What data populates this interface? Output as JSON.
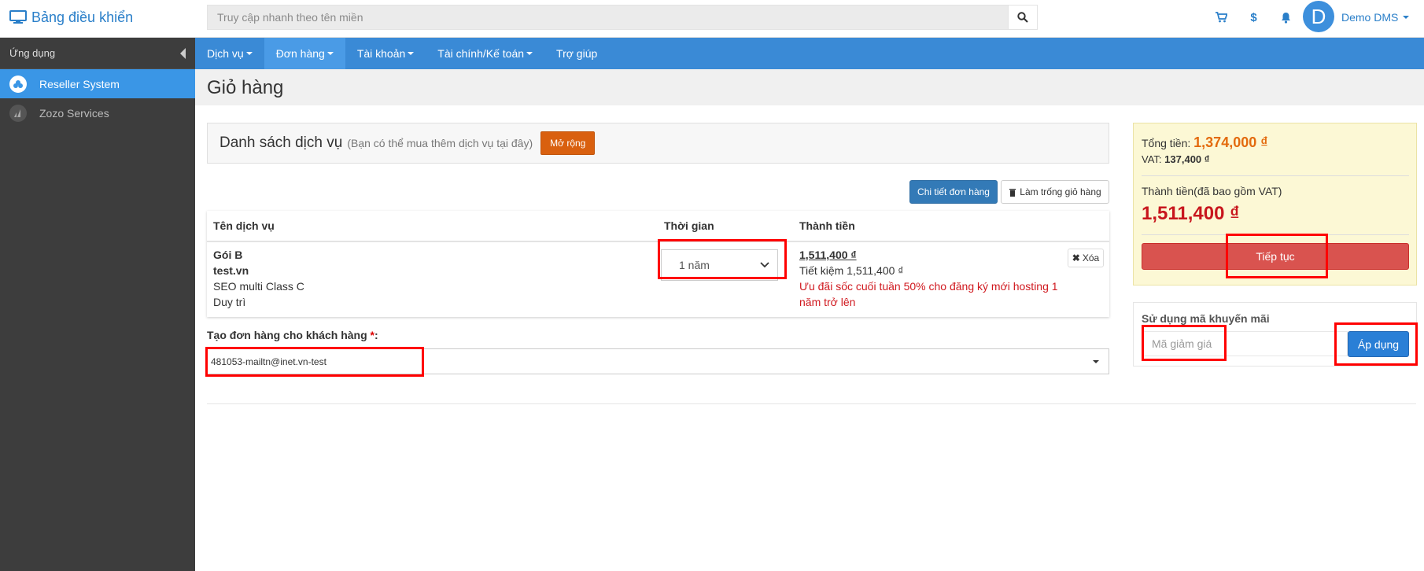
{
  "brand": {
    "title": "Bảng điều khiển"
  },
  "search": {
    "placeholder": "Truy cập nhanh theo tên miền"
  },
  "user": {
    "initial": "D",
    "name": "Demo DMS"
  },
  "sidebar": {
    "header": "Ứng dụng",
    "items": [
      {
        "label": "Reseller System",
        "icon": "cloud-icon",
        "active": true
      },
      {
        "label": "Zozo Services",
        "icon": "chart-icon",
        "active": false
      }
    ]
  },
  "nav": {
    "items": [
      {
        "label": "Dịch vụ",
        "dropdown": true
      },
      {
        "label": "Đơn hàng",
        "dropdown": true
      },
      {
        "label": "Tài khoản",
        "dropdown": true
      },
      {
        "label": "Tài chính/Kế toán",
        "dropdown": true
      },
      {
        "label": "Trợ giúp",
        "dropdown": false
      }
    ]
  },
  "page": {
    "title": "Giỏ hàng"
  },
  "service_list": {
    "title": "Danh sách dịch vụ",
    "subtitle": "(Bạn có thể mua thêm dịch vụ tại đây)",
    "expand_label": "Mở rộng"
  },
  "actions": {
    "detail_label": "Chi tiết đơn hàng",
    "empty_label": "Làm trống giỏ hàng"
  },
  "table": {
    "headers": {
      "service": "Tên dịch vụ",
      "duration": "Thời gian",
      "amount": "Thành tiền"
    },
    "row": {
      "plan": "Gói B",
      "domain": "test.vn",
      "product": "SEO multi Class C",
      "type": "Duy trì",
      "duration": "1 năm",
      "price": "1,511,400 ₫",
      "saving": "Tiết kiệm 1,511,400 ₫",
      "promo_line1": "Ưu đãi sốc cuối tuần 50% cho đăng ký mới hosting 1",
      "promo_line2": "năm trở lên",
      "remove_label": "Xóa"
    }
  },
  "customer": {
    "label": "Tạo đơn hàng cho khách hàng",
    "required_mark": "*",
    "colon": ":",
    "value": "481053-mailtn@inet.vn-test"
  },
  "summary": {
    "total_label": "Tổng tiền:",
    "total_value": "1,374,000 ₫",
    "vat_label": "VAT:",
    "vat_value": "137,400 ₫",
    "grand_label": "Thành tiền(đã bao gồm VAT)",
    "grand_value": "1,511,400 ₫",
    "continue_label": "Tiếp tục"
  },
  "promo": {
    "title": "Sử dụng mã khuyến mãi",
    "placeholder": "Mã giảm giá",
    "apply_label": "Áp dụng"
  },
  "colors": {
    "accent": "#3a8ad6",
    "highlight": "#ff0000",
    "danger": "#d9534f",
    "warning": "#d9600f"
  }
}
